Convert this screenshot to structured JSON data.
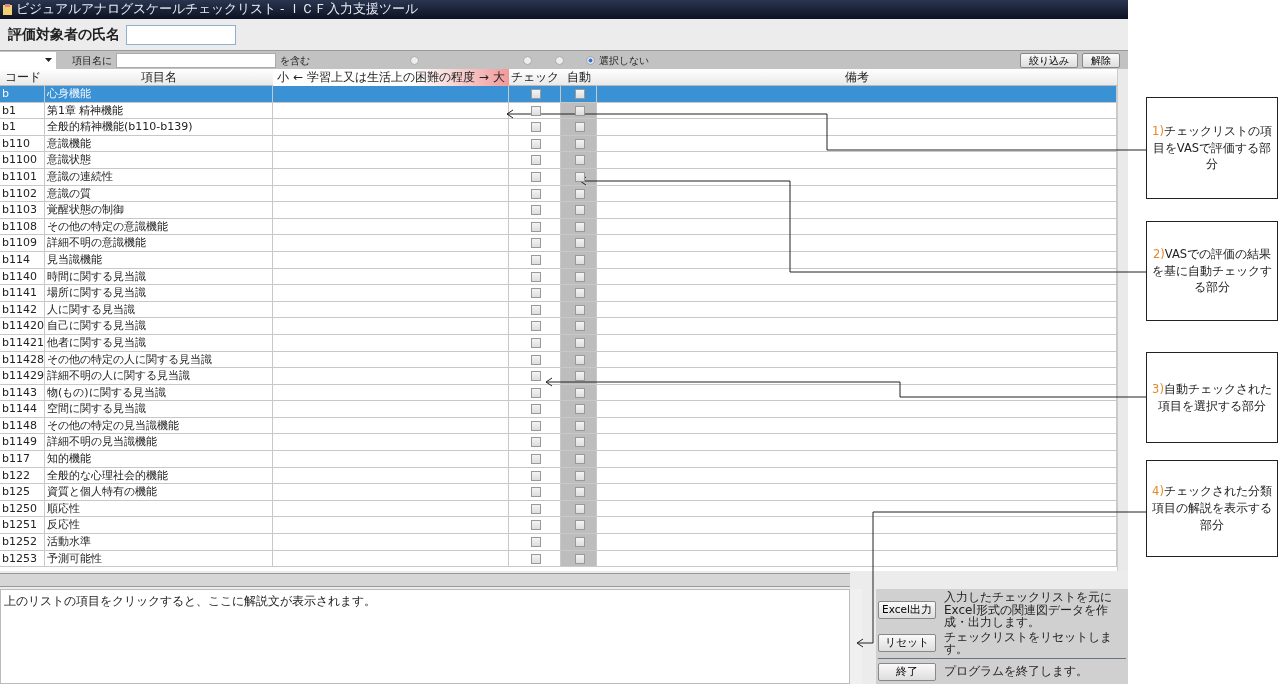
{
  "window": {
    "title": "ビジュアルアナログスケールチェックリスト - ＩＣＦ入力支援ツール"
  },
  "subject": {
    "label": "評価対象者の氏名"
  },
  "filter": {
    "prefix": "項目名に",
    "suffix": "を含む",
    "radios": [
      {
        "selected": false
      },
      {
        "selected": false
      },
      {
        "selected": false
      },
      {
        "label": "選択しない",
        "selected": true
      }
    ],
    "buttons": [
      "絞り込み",
      "解除"
    ]
  },
  "table": {
    "columns": [
      "コード",
      "項目名",
      "小 ← 学習上又は生活上の困難の程度 → 大",
      "チェック",
      "自動",
      "備考"
    ],
    "rows": [
      {
        "code": "b",
        "name": "心身機能",
        "selected": true,
        "checked": false,
        "auto": false
      },
      {
        "code": "b1",
        "name": "第1章 精神機能",
        "selected": false,
        "checked": false,
        "auto": false
      },
      {
        "code": "b1",
        "name": "全般的精神機能(b110-b139)",
        "selected": false,
        "checked": false,
        "auto": false
      },
      {
        "code": "b110",
        "name": "意識機能",
        "selected": false,
        "checked": false,
        "auto": false
      },
      {
        "code": "b1100",
        "name": "意識状態",
        "selected": false,
        "checked": false,
        "auto": false
      },
      {
        "code": "b1101",
        "name": "意識の連続性",
        "selected": false,
        "checked": false,
        "auto": false
      },
      {
        "code": "b1102",
        "name": "意識の質",
        "selected": false,
        "checked": false,
        "auto": false
      },
      {
        "code": "b1103",
        "name": "覚醒状態の制御",
        "selected": false,
        "checked": false,
        "auto": false
      },
      {
        "code": "b1108",
        "name": "その他の特定の意識機能",
        "selected": false,
        "checked": false,
        "auto": false
      },
      {
        "code": "b1109",
        "name": "詳細不明の意識機能",
        "selected": false,
        "checked": false,
        "auto": false
      },
      {
        "code": "b114",
        "name": "見当識機能",
        "selected": false,
        "checked": false,
        "auto": false
      },
      {
        "code": "b1140",
        "name": "時間に関する見当識",
        "selected": false,
        "checked": false,
        "auto": false
      },
      {
        "code": "b1141",
        "name": "場所に関する見当識",
        "selected": false,
        "checked": false,
        "auto": false
      },
      {
        "code": "b1142",
        "name": "人に関する見当識",
        "selected": false,
        "checked": false,
        "auto": false
      },
      {
        "code": "b11420",
        "name": "自己に関する見当識",
        "selected": false,
        "checked": false,
        "auto": false
      },
      {
        "code": "b11421",
        "name": "他者に関する見当識",
        "selected": false,
        "checked": false,
        "auto": false
      },
      {
        "code": "b11428",
        "name": "その他の特定の人に関する見当識",
        "selected": false,
        "checked": false,
        "auto": false
      },
      {
        "code": "b11429",
        "name": "詳細不明の人に関する見当識",
        "selected": false,
        "checked": false,
        "auto": false
      },
      {
        "code": "b1143",
        "name": "物(もの)に関する見当識",
        "selected": false,
        "checked": false,
        "auto": false
      },
      {
        "code": "b1144",
        "name": "空間に関する見当識",
        "selected": false,
        "checked": false,
        "auto": false
      },
      {
        "code": "b1148",
        "name": "その他の特定の見当識機能",
        "selected": false,
        "checked": false,
        "auto": false
      },
      {
        "code": "b1149",
        "name": "詳細不明の見当識機能",
        "selected": false,
        "checked": false,
        "auto": false
      },
      {
        "code": "b117",
        "name": "知的機能",
        "selected": false,
        "checked": false,
        "auto": false
      },
      {
        "code": "b122",
        "name": "全般的な心理社会的機能",
        "selected": false,
        "checked": false,
        "auto": false
      },
      {
        "code": "b125",
        "name": "資質と個人特有の機能",
        "selected": false,
        "checked": false,
        "auto": false
      },
      {
        "code": "b1250",
        "name": "順応性",
        "selected": false,
        "checked": false,
        "auto": false
      },
      {
        "code": "b1251",
        "name": "反応性",
        "selected": false,
        "checked": false,
        "auto": false
      },
      {
        "code": "b1252",
        "name": "活動水準",
        "selected": false,
        "checked": false,
        "auto": false
      },
      {
        "code": "b1253",
        "name": "予測可能性",
        "selected": false,
        "checked": false,
        "auto": false
      }
    ]
  },
  "description": {
    "text": "上のリストの項目をクリックすると、ここに解説文が表示されます。"
  },
  "actions": [
    {
      "button": "Excel出力",
      "text": "入力したチェックリストを元にExcel形式の関連図データを作成・出力します。"
    },
    {
      "button": "リセット",
      "text": "チェックリストをリセットします。"
    },
    {
      "button": "終了",
      "text": "プログラムを終了します。"
    }
  ],
  "annotations": [
    {
      "number": "1)",
      "text": "チェックリストの項目をVASで評価する部分"
    },
    {
      "number": "2)",
      "text": "VASでの評価の結果を基に自動チェックする部分"
    },
    {
      "number": "3)",
      "text": "自動チェックされた項目を選択する部分"
    },
    {
      "number": "4)",
      "text": "チェックされた分類項目の解説を表示する部分"
    }
  ]
}
